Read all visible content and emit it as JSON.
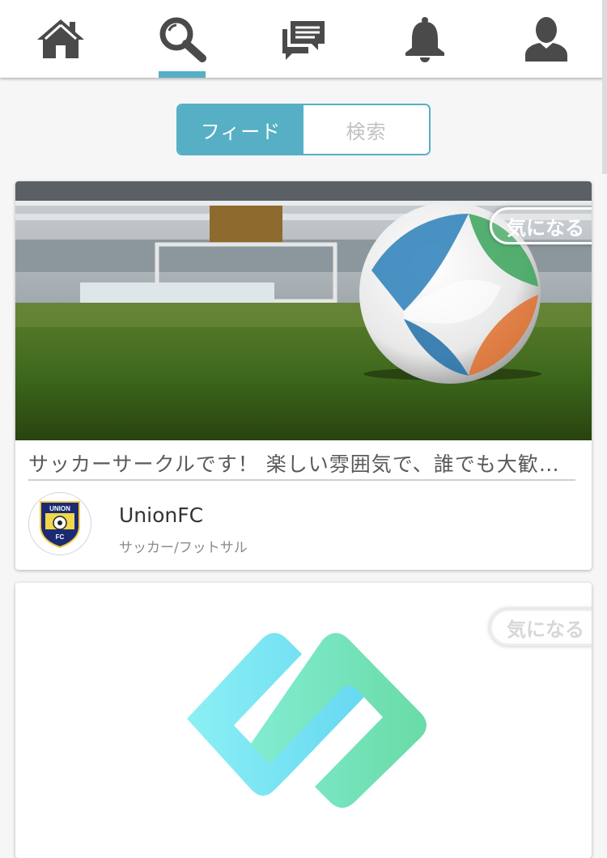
{
  "nav": {
    "items": [
      {
        "id": "home",
        "icon": "home-icon"
      },
      {
        "id": "search",
        "icon": "search-icon",
        "active": true
      },
      {
        "id": "messages",
        "icon": "chat-icon"
      },
      {
        "id": "notifications",
        "icon": "bell-icon"
      },
      {
        "id": "profile",
        "icon": "user-icon"
      }
    ],
    "icon_color": "#4a4a4a",
    "accent": "#56afc5"
  },
  "segment": {
    "feed_label": "フィード",
    "search_label": "検索",
    "selected": "feed"
  },
  "cards": [
    {
      "favorite_label": "気になる",
      "title": "サッカーサークルです！ 楽しい雰囲気で、誰でも大歓迎です！",
      "club_name": "UnionFC",
      "category": "サッカー/フットサル",
      "logo_text_top": "UNION",
      "logo_text_bottom": "FC"
    },
    {
      "favorite_label": "気になる"
    }
  ]
}
